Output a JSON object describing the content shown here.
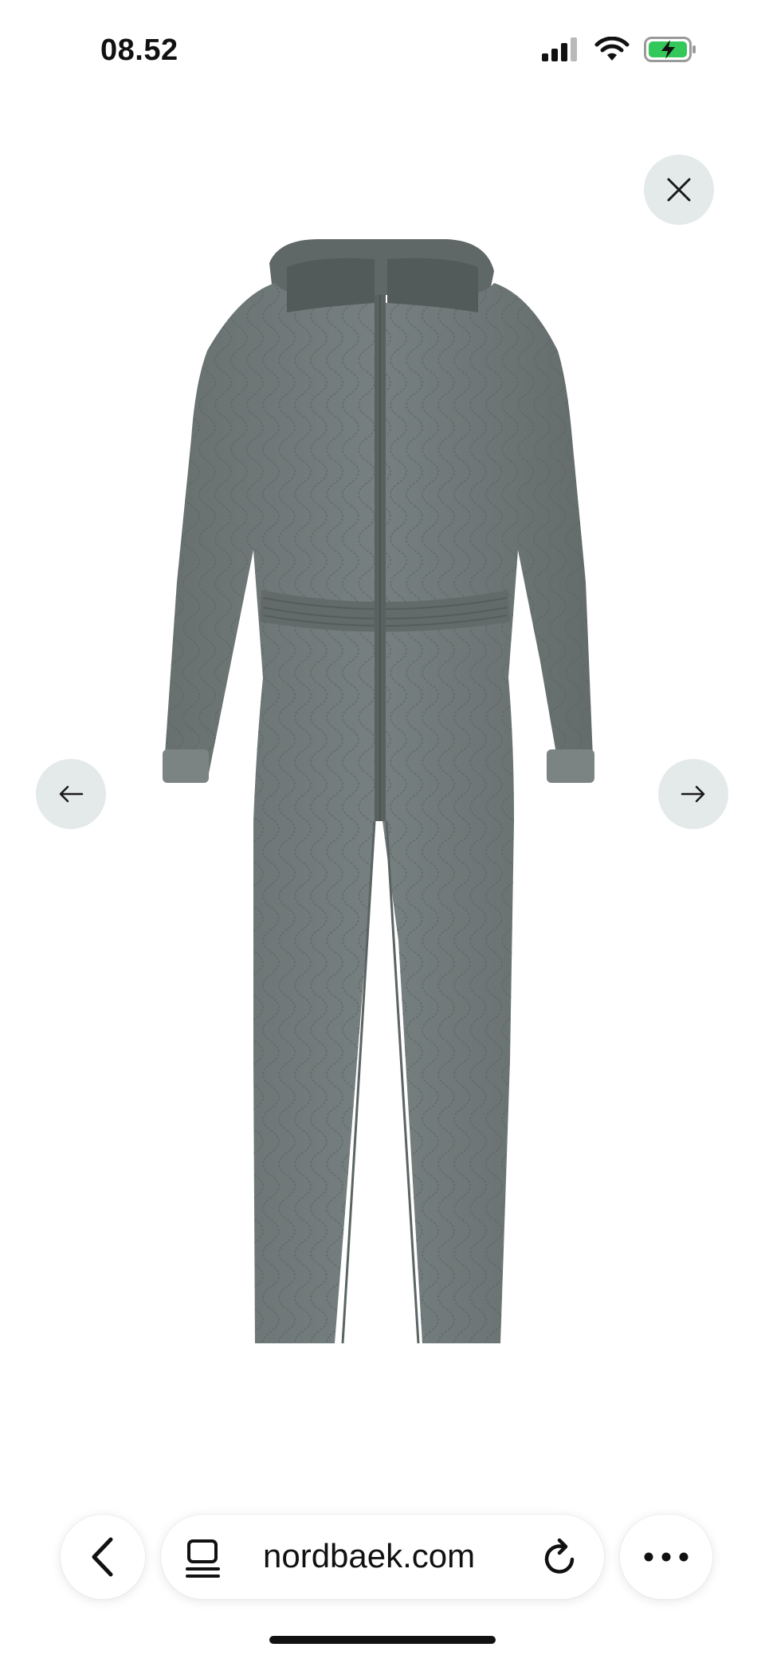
{
  "status_bar": {
    "time": "08.52",
    "battery_state": "charging"
  },
  "viewer": {
    "image_alt": "Grey quilted hooded jumpsuit",
    "colors": {
      "garment": "#6f7877",
      "garment_dark": "#5d6665",
      "button_bg": "#e4e9ea"
    },
    "icons": {
      "close": "close-icon",
      "prev": "arrow-left-icon",
      "next": "arrow-right-icon"
    }
  },
  "browser": {
    "url": "nordbaek.com",
    "icons": {
      "back": "chevron-left-icon",
      "reader": "reader-icon",
      "reload": "reload-icon",
      "more": "more-icon"
    }
  }
}
